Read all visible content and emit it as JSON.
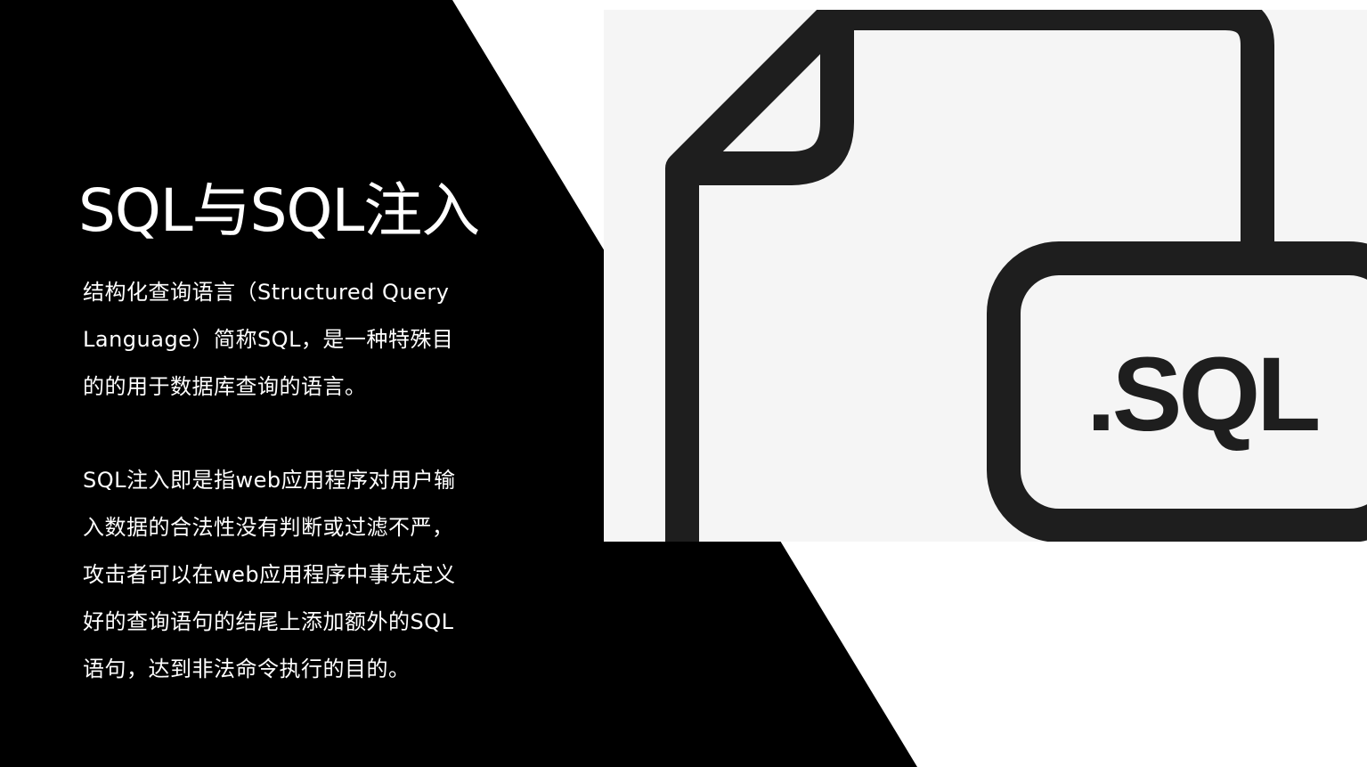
{
  "slide": {
    "title": "SQL与SQL注入",
    "paragraphs": [
      " 结构化查询语言（Structured Query\nLanguage）简称SQL，是一种特殊目\n的的用于数据库查询的语言。",
      "SQL注入即是指web应用程序对用户输\n入数据的合法性没有判断或过滤不严，\n攻击者可以在web应用程序中事先定义\n好的查询语句的结尾上添加额外的SQL\n语句，达到非法命令执行的目的。"
    ]
  },
  "illustration": {
    "icon": "sql-file-icon",
    "label": ".SQL"
  },
  "colors": {
    "background": "#ffffff",
    "triangle": "#000000",
    "text": "#ffffff",
    "illustration_bg": "#f5f5f5",
    "illustration_stroke": "#1e1e1e"
  }
}
